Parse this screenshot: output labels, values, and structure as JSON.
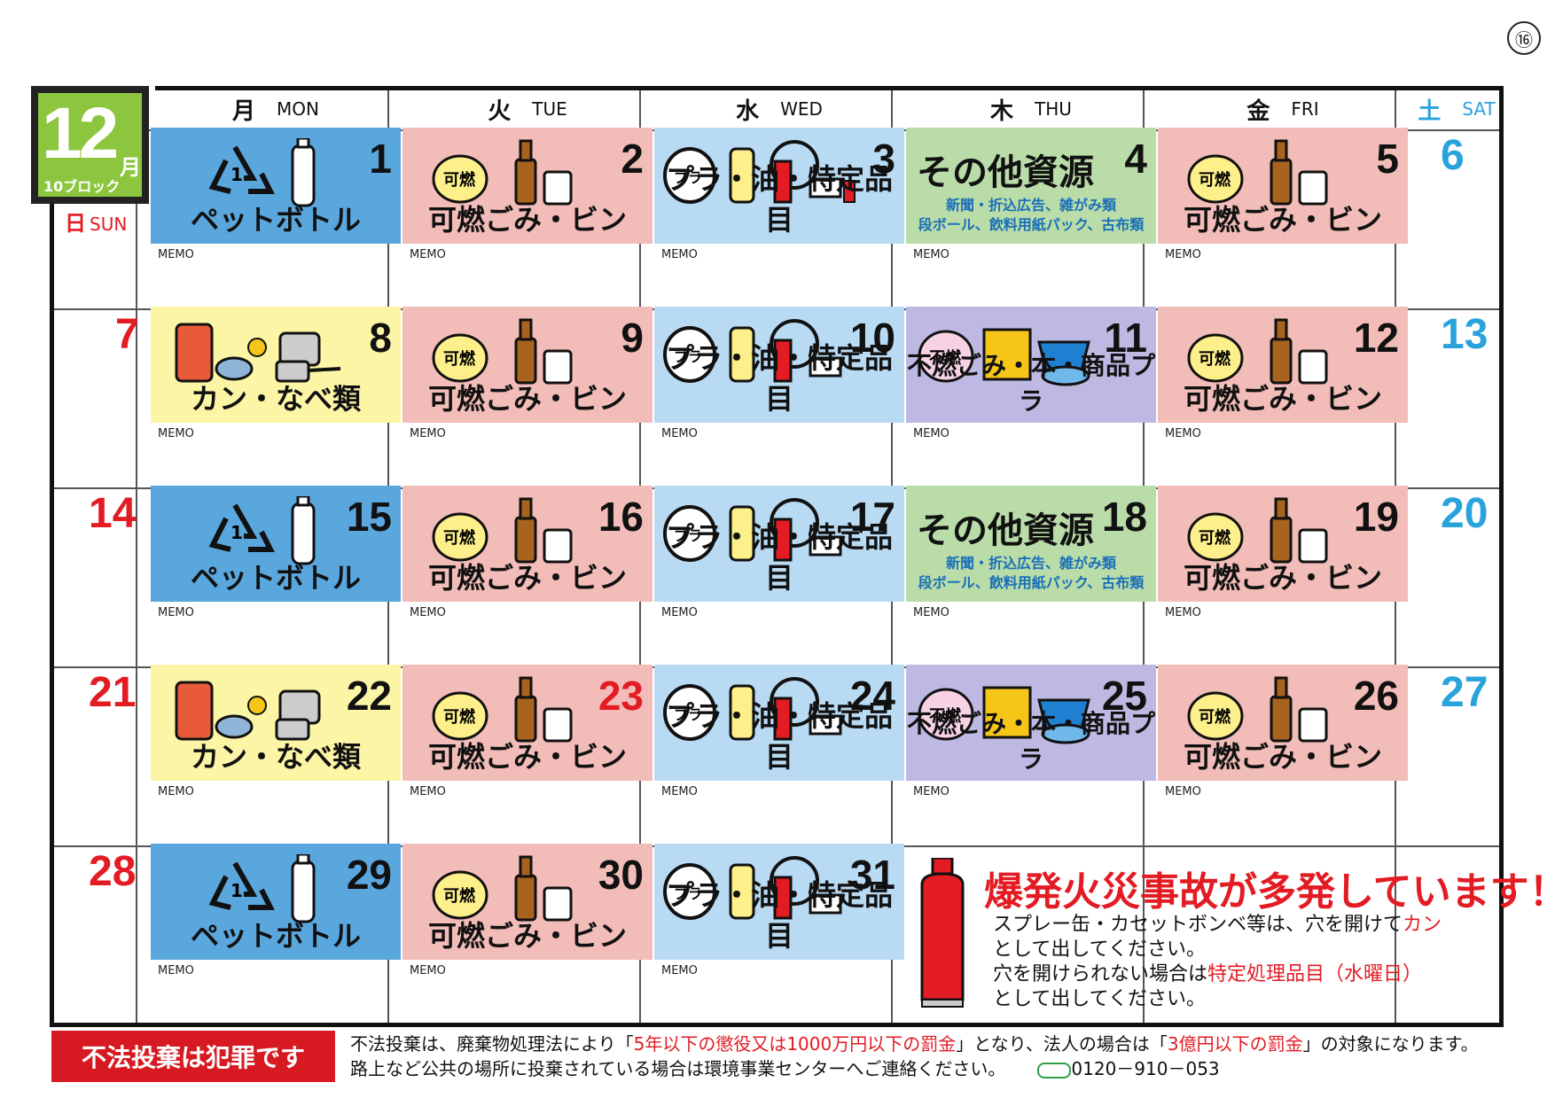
{
  "page_number": "⑯",
  "month": {
    "number": "12",
    "suffix": "月",
    "block": "10ブロック"
  },
  "headers": {
    "sun": {
      "jp": "日",
      "en": "SUN"
    },
    "days": [
      {
        "jp": "月",
        "en": "MON"
      },
      {
        "jp": "火",
        "en": "TUE"
      },
      {
        "jp": "水",
        "en": "WED"
      },
      {
        "jp": "木",
        "en": "THU"
      },
      {
        "jp": "金",
        "en": "FRI"
      },
      {
        "jp": "土",
        "en": "SAT"
      }
    ]
  },
  "memo_label": "MEMO",
  "sundays": [
    "7",
    "14",
    "21",
    "28"
  ],
  "saturdays": [
    "6",
    "13",
    "20",
    "27"
  ],
  "categories": {
    "pet": "ペットボトル",
    "burn": "可燃ごみ・ビン",
    "plastic": "プラ・油・特定品目",
    "other": "その他資源",
    "other_sub1": "新聞・折込広告、雑がみ類",
    "other_sub2": "段ボール、飲料用紙パック、古布類",
    "can": "カン・なべ類",
    "nonburn": "不燃ごみ・本・商品プラ",
    "burn_bag": "可燃",
    "nonburn_bag": "不燃",
    "gas": "ガス"
  },
  "weeks": [
    [
      "1",
      "2",
      "3",
      "4",
      "5"
    ],
    [
      "8",
      "9",
      "10",
      "11",
      "12"
    ],
    [
      "15",
      "16",
      "17",
      "18",
      "19"
    ],
    [
      "22",
      "23",
      "24",
      "25",
      "26"
    ],
    [
      "29",
      "30",
      "31"
    ]
  ],
  "warning": {
    "title": "爆発火災事故が多発しています！",
    "line1_a": "スプレー缶・カセットボンベ等は、穴を開けて",
    "line1_b": "カン",
    "line2": "として出してください。",
    "line3_a": "穴を開けられない場合は",
    "line3_b": "特定処理品目（水曜日）",
    "line4": "として出してください。"
  },
  "footer": {
    "badge": "不法投棄は犯罪です",
    "line1_a": "不法投棄は、廃棄物処理法により「",
    "line1_b": "5年以下の懲役又は1000万円以下の罰金",
    "line1_c": "」となり、法人の場合は「",
    "line1_d": "3億円以下の罰金",
    "line1_e": "」の対象になります。",
    "line2": "路上など公共の場所に投棄されている場合は環境事業センターへご連絡ください。",
    "phone": "0120－910－053"
  }
}
